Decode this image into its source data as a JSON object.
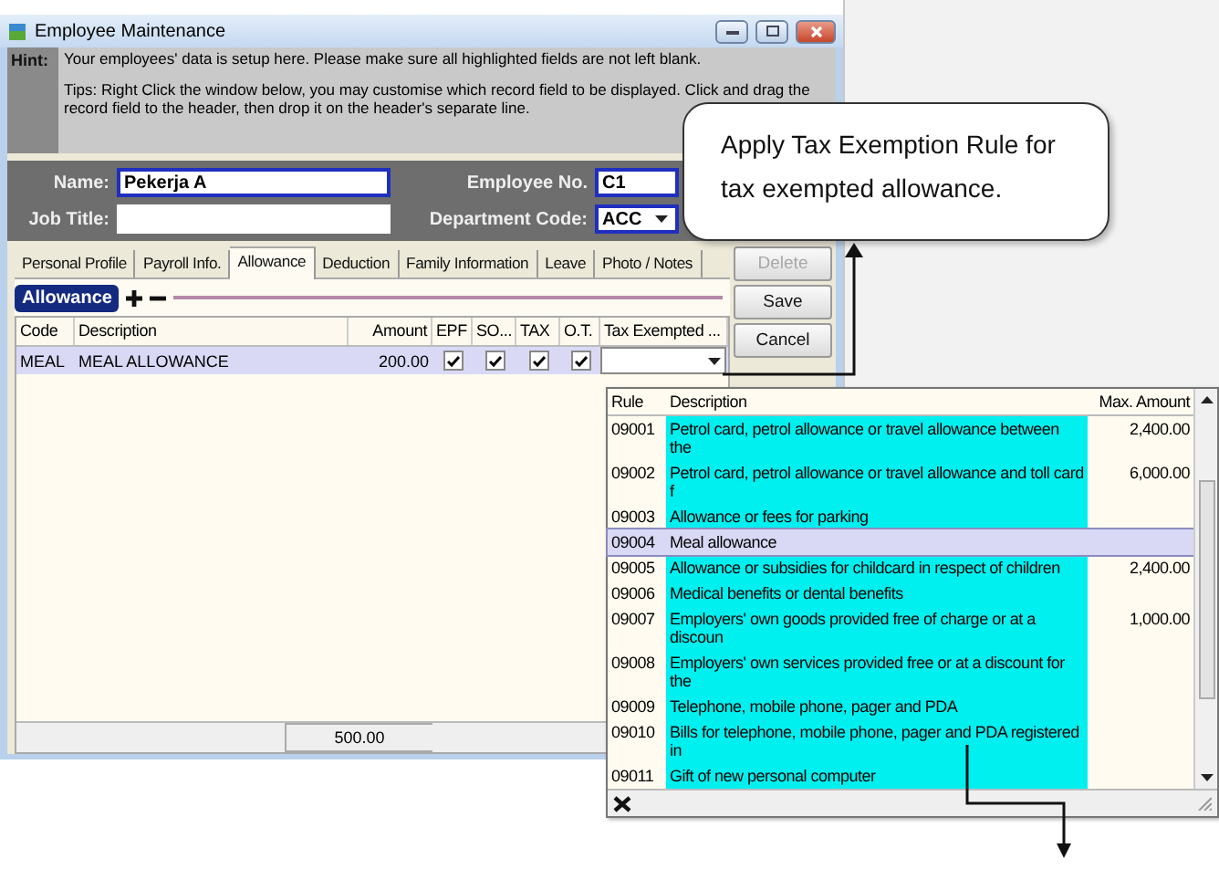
{
  "window": {
    "title": "Employee Maintenance"
  },
  "hint": {
    "label": "Hint:",
    "paragraphs": [
      "Your employees' data is setup here. Please make sure all highlighted fields are not left blank.",
      "Tips: Right Click the window below, you may customise which record field to be displayed. Click and drag the record field to the header, then drop it on the header's separate line."
    ]
  },
  "form": {
    "fields": [
      {
        "label": "Name:",
        "value": "Pekerja A",
        "highlighted": true,
        "kind": "text"
      },
      {
        "label": "Employee No.",
        "value": "C1",
        "highlighted": true,
        "kind": "text"
      },
      {
        "label": "Job Title:",
        "highlighted": false,
        "kind": "text"
      },
      {
        "label": "Department Code:",
        "value": "ACC",
        "highlighted": true,
        "kind": "select"
      }
    ]
  },
  "tabs": [
    {
      "label": "Personal Profile",
      "selected": false
    },
    {
      "label": "Payroll Info.",
      "selected": false
    },
    {
      "label": "Allowance",
      "selected": true
    },
    {
      "label": "Deduction",
      "selected": false
    },
    {
      "label": "Family Information",
      "selected": false
    },
    {
      "label": "Leave",
      "selected": false
    },
    {
      "label": "Photo / Notes",
      "selected": false
    }
  ],
  "section": {
    "title": "Allowance"
  },
  "table": {
    "columns": [
      "Code",
      "Description",
      "Amount",
      "EPF",
      "SO...",
      "TAX",
      "O.T.",
      "Tax Exempted ..."
    ],
    "rows": [
      {
        "code": "MEAL",
        "description": "MEAL ALLOWANCE",
        "amount": "200.00",
        "epf": true,
        "so": true,
        "tax": true,
        "ot": true,
        "selected": true
      }
    ],
    "total": "500.00"
  },
  "buttons": [
    {
      "label": "Delete",
      "disabled": true
    },
    {
      "label": "Save",
      "disabled": false
    },
    {
      "label": "Cancel",
      "disabled": false
    }
  ],
  "tax_rule_popup": {
    "columns": [
      "Rule",
      "Description",
      "Max. Amount"
    ],
    "rows": [
      {
        "rule": "09001",
        "description": "Petrol card, petrol allowance or travel allowance between the",
        "max_amount": "2,400.00",
        "selected": false
      },
      {
        "rule": "09002",
        "description": "Petrol card, petrol allowance or travel allowance and toll card f",
        "max_amount": "6,000.00",
        "selected": false
      },
      {
        "rule": "09003",
        "description": "Allowance or fees for parking",
        "selected": false
      },
      {
        "rule": "09004",
        "description": "Meal allowance",
        "selected": true
      },
      {
        "rule": "09005",
        "description": "Allowance or subsidies for childcard in respect of children",
        "max_amount": "2,400.00",
        "selected": false
      },
      {
        "rule": "09006",
        "description": "Medical benefits or dental benefits",
        "selected": false
      },
      {
        "rule": "09007",
        "description": "Employers' own goods provided free of charge or at a discoun",
        "max_amount": "1,000.00",
        "selected": false
      },
      {
        "rule": "09008",
        "description": "Employers' own services provided free or at a discount for the",
        "selected": false
      },
      {
        "rule": "09009",
        "description": "Telephone, mobile phone, pager and PDA",
        "selected": false
      },
      {
        "rule": "09010",
        "description": "Bills for telephone, mobile phone, pager and PDA registered in",
        "selected": false
      },
      {
        "rule": "09011",
        "description": "Gift of new personal computer",
        "selected": false
      }
    ]
  },
  "callout": {
    "text": "Apply Tax Exemption Rule for tax exempted allowance."
  }
}
